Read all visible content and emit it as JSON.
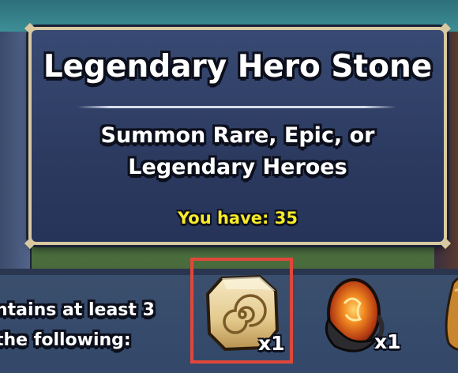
{
  "tooltip": {
    "title": "Legendary Hero Stone",
    "description_line1": "Summon Rare, Epic, or",
    "description_line2": "Legendary Heroes",
    "you_have_label": "You have: 35"
  },
  "contents": {
    "label_line1": "ntains at least 3",
    "label_line2": "the following:",
    "items": [
      {
        "icon": "hero-stone-icon",
        "quantity": "x1",
        "selected": true
      },
      {
        "icon": "dragon-egg-icon",
        "quantity": "x1",
        "selected": false
      }
    ]
  },
  "colors": {
    "selection_border": "#e0473a",
    "you_have_text": "#f7ea2a",
    "panel_border": "#d8c9a0",
    "panel_bg": "#2c3a60"
  }
}
